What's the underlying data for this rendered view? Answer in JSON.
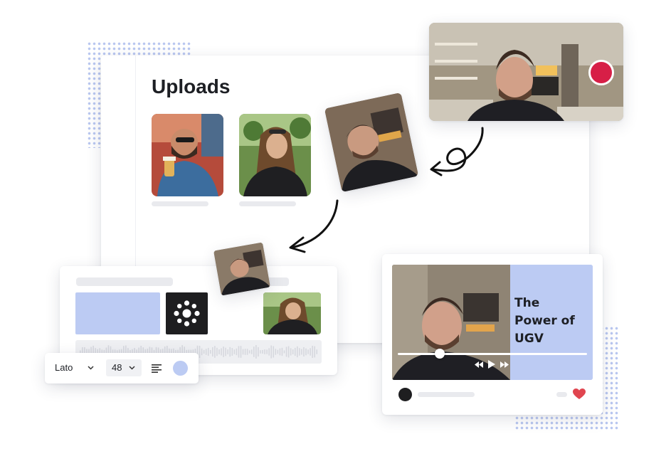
{
  "uploads": {
    "title": "Uploads"
  },
  "editor": {
    "font_name": "Lato",
    "font_size": "48",
    "font_chevron_icon": "chevron-down-icon",
    "size_chevron_icon": "chevron-down-icon",
    "align_icon": "align-left-icon",
    "color_swatch": "#bccbf3"
  },
  "player": {
    "title_line1": "The",
    "title_line2": "Power of",
    "title_line3": "UGV",
    "progress": 0.22,
    "controls": [
      "rewind-icon",
      "play-icon",
      "fast-forward-icon"
    ],
    "like_icon": "heart-icon"
  },
  "recorder": {
    "record_icon": "record-icon",
    "record_color": "#d71f47"
  },
  "colors": {
    "accent": "#bccbf3",
    "heart": "#e0454f",
    "dark_tile": "#1e1e20"
  }
}
